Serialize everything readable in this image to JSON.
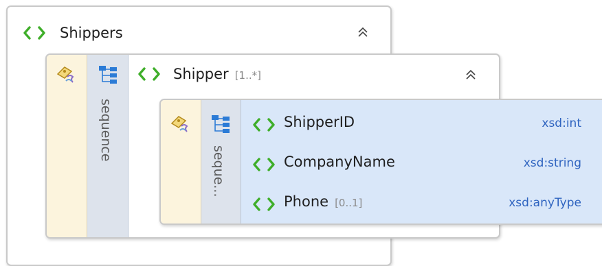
{
  "colors": {
    "element_icon": "#3fae2a",
    "type_text": "#2f64c0",
    "selection_bg": "#d9e7f9",
    "attribute_strip": "#fcf4dd",
    "sequence_strip": "#dde3ec"
  },
  "icons": {
    "element": "element-chevrons-icon",
    "attributes": "attributes-icon",
    "sequence": "sequence-tree-icon",
    "collapse": "chevrons-up-icon"
  },
  "shippers": {
    "name": "Shippers"
  },
  "shipper": {
    "name": "Shipper",
    "cardinality": "[1..*]",
    "sequence_label": "sequence"
  },
  "inner": {
    "sequence_label": "seque...",
    "children": [
      {
        "name": "ShipperID",
        "cardinality": "",
        "type": "xsd:int"
      },
      {
        "name": "CompanyName",
        "cardinality": "",
        "type": "xsd:string"
      },
      {
        "name": "Phone",
        "cardinality": "[0..1]",
        "type": "xsd:anyType"
      }
    ]
  }
}
